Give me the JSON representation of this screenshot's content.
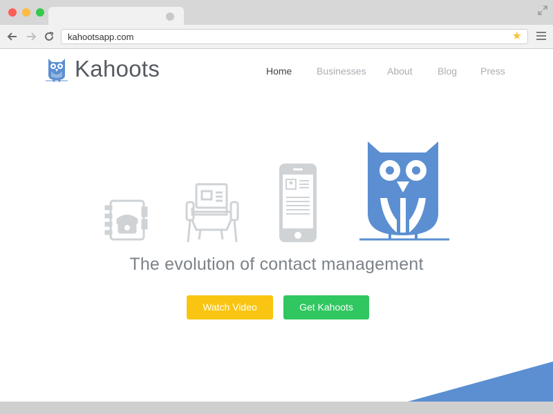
{
  "browser": {
    "url": "kahootsapp.com"
  },
  "site": {
    "brand": "Kahoots",
    "nav": [
      {
        "label": "Home",
        "active": true
      },
      {
        "label": "Businesses",
        "active": false
      },
      {
        "label": "About",
        "active": false
      },
      {
        "label": "Blog",
        "active": false
      },
      {
        "label": "Press",
        "active": false
      }
    ],
    "tagline": "The evolution of contact management",
    "buttons": {
      "watch_video": "Watch Video",
      "get_kahoots": "Get Kahoots"
    }
  },
  "colors": {
    "brand_blue": "#5b8fd1",
    "watch_yellow": "#f9c512",
    "get_green": "#30c760",
    "icon_gray": "#cfd3d6",
    "text_gray": "#7c8288"
  },
  "icons": {
    "illustration": [
      "address-book-icon",
      "rolodex-icon",
      "smartphone-icon",
      "owl-mascot-icon"
    ]
  }
}
